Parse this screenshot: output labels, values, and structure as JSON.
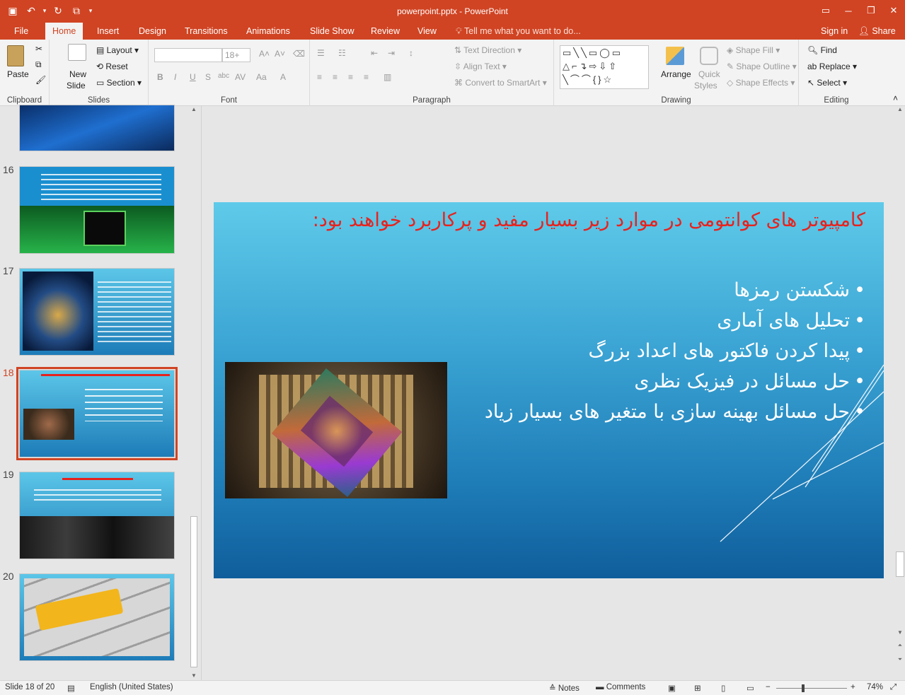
{
  "window": {
    "title": "powerpoint.pptx - PowerPoint"
  },
  "tabs": [
    "File",
    "Home",
    "Insert",
    "Design",
    "Transitions",
    "Animations",
    "Slide Show",
    "Review",
    "View"
  ],
  "active_tab": "Home",
  "tell_me": "Tell me what you want to do...",
  "account": {
    "signin": "Sign in",
    "share": "Share"
  },
  "ribbon": {
    "clipboard": {
      "label": "Clipboard",
      "paste": "Paste"
    },
    "slides": {
      "label": "Slides",
      "new_slide_1": "New",
      "new_slide_2": "Slide",
      "layout": "Layout",
      "reset": "Reset",
      "section": "Section"
    },
    "font": {
      "label": "Font",
      "size": "18+"
    },
    "paragraph": {
      "label": "Paragraph",
      "text_direction": "Text Direction",
      "align_text": "Align Text",
      "smartart": "Convert to SmartArt"
    },
    "drawing": {
      "label": "Drawing",
      "arrange": "Arrange",
      "quick_styles_1": "Quick",
      "quick_styles_2": "Styles",
      "shape_fill": "Shape Fill",
      "shape_outline": "Shape Outline",
      "shape_effects": "Shape Effects"
    },
    "editing": {
      "label": "Editing",
      "find": "Find",
      "replace": "Replace",
      "select": "Select"
    }
  },
  "thumbnails": [
    {
      "num": "16"
    },
    {
      "num": "17"
    },
    {
      "num": "18"
    },
    {
      "num": "19"
    },
    {
      "num": "20"
    }
  ],
  "slide": {
    "title": "کامپیوتر های کوانتومی در موارد زیر بسیار مفید و پرکاربرد خواهند بود:",
    "bullets": [
      "شکستن رمزها",
      "تحلیل های آماری",
      "پیدا کردن فاکتور های اعداد بزرگ",
      "حل مسائل در فیزیک نظری",
      "حل مسائل بهینه سازی با متغیر های بسیار زیاد"
    ]
  },
  "status": {
    "slide_info": "Slide 18 of 20",
    "language": "English (United States)",
    "notes": "Notes",
    "comments": "Comments",
    "zoom": "74%"
  },
  "colors": {
    "accent": "#d04423",
    "title_red": "#e8221d"
  }
}
